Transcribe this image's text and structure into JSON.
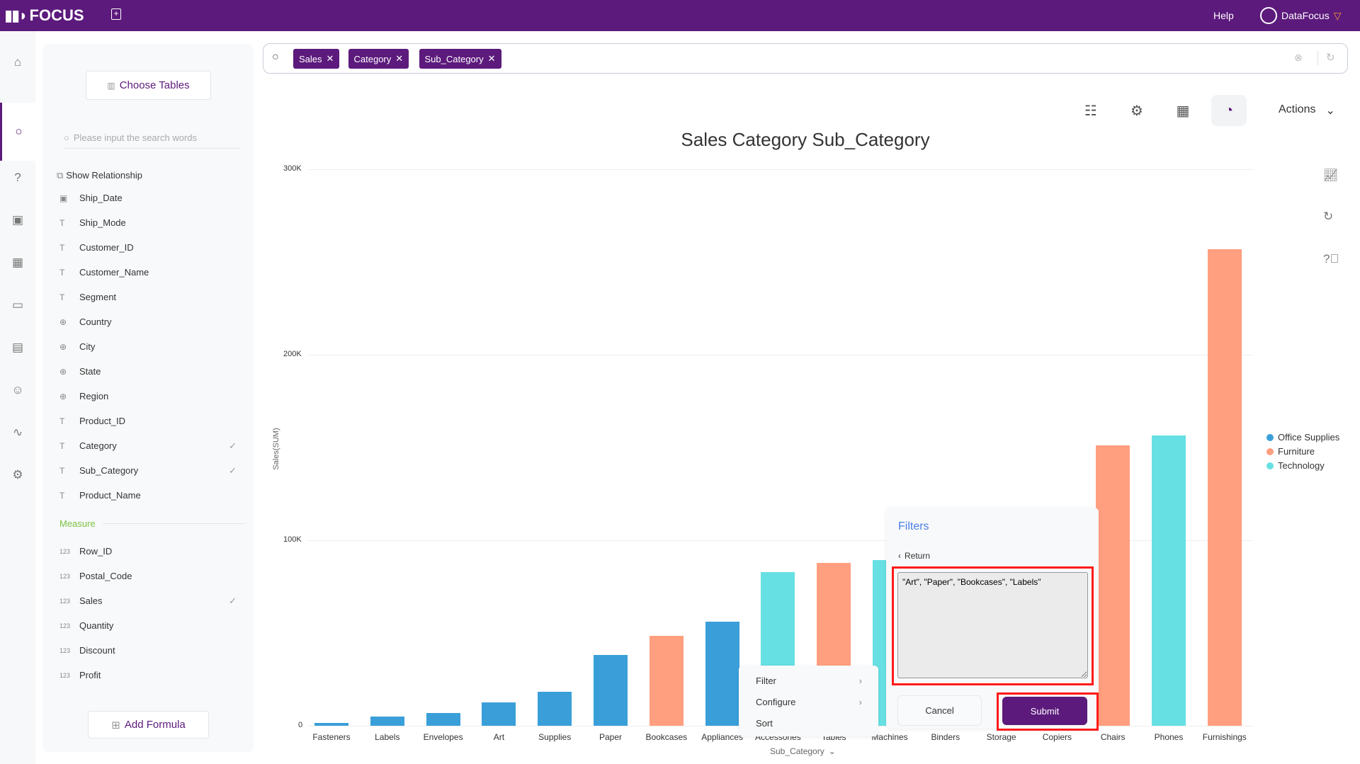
{
  "topbar": {
    "logo": "FOCUS",
    "help": "Help",
    "user": "DataFocus"
  },
  "rail": [
    "home-icon",
    "search-icon",
    "help-icon",
    "presentation-icon",
    "table-icon",
    "folder-icon",
    "clipboard-icon",
    "user-icon",
    "pulse-icon",
    "settings-icon"
  ],
  "panel": {
    "choose_tables": "Choose Tables",
    "search_placeholder": "Please input the search words",
    "show_relationship": "Show Relationship",
    "attributes": [
      {
        "name": "Ship_Date",
        "type": "date",
        "checked": false
      },
      {
        "name": "Ship_Mode",
        "type": "text",
        "checked": false
      },
      {
        "name": "Customer_ID",
        "type": "text",
        "checked": false
      },
      {
        "name": "Customer_Name",
        "type": "text",
        "checked": false
      },
      {
        "name": "Segment",
        "type": "text",
        "checked": false
      },
      {
        "name": "Country",
        "type": "geo",
        "checked": false
      },
      {
        "name": "City",
        "type": "geo",
        "checked": false
      },
      {
        "name": "State",
        "type": "geo",
        "checked": false
      },
      {
        "name": "Region",
        "type": "geo",
        "checked": false
      },
      {
        "name": "Product_ID",
        "type": "text",
        "checked": false
      },
      {
        "name": "Category",
        "type": "text",
        "checked": true
      },
      {
        "name": "Sub_Category",
        "type": "text",
        "checked": true
      },
      {
        "name": "Product_Name",
        "type": "text",
        "checked": false
      }
    ],
    "measure_label": "Measure",
    "measures": [
      {
        "name": "Row_ID",
        "checked": false
      },
      {
        "name": "Postal_Code",
        "checked": false
      },
      {
        "name": "Sales",
        "checked": true
      },
      {
        "name": "Quantity",
        "checked": false
      },
      {
        "name": "Discount",
        "checked": false
      },
      {
        "name": "Profit",
        "checked": false
      }
    ],
    "add_formula": "Add Formula"
  },
  "search": {
    "tags": [
      "Sales",
      "Category",
      "Sub_Category"
    ]
  },
  "toolbar": {
    "actions": "Actions"
  },
  "menu": {
    "filter": "Filter",
    "configure": "Configure",
    "sort": "Sort"
  },
  "filters": {
    "title": "Filters",
    "return": "Return",
    "value": "\"Art\", \"Paper\", \"Bookcases\", \"Labels\"",
    "cancel": "Cancel",
    "submit": "Submit"
  },
  "colors": {
    "brand": "#5c1a7c",
    "Office Supplies": "#3a9fd9",
    "Furniture": "#ff9f7f",
    "Technology": "#67e0e3",
    "highlight": "#ff1a1a"
  },
  "chart_data": {
    "type": "bar",
    "title": "Sales Category Sub_Category",
    "xlabel": "Sub_Category",
    "ylabel": "Sales(SUM)",
    "ylim": [
      0,
      300000
    ],
    "yticks": [
      "0",
      "100K",
      "200K",
      "300K"
    ],
    "grid": true,
    "legend_position": "right",
    "legend": [
      "Office Supplies",
      "Furniture",
      "Technology"
    ],
    "categories": [
      "Fasteners",
      "Labels",
      "Envelopes",
      "Art",
      "Supplies",
      "Paper",
      "Bookcases",
      "Appliances",
      "Accessories",
      "Tables",
      "Machines",
      "Binders",
      "Storage",
      "Copiers",
      "Chairs",
      "Phones",
      "Furnishings"
    ],
    "series_of": [
      "Office Supplies",
      "Office Supplies",
      "Office Supplies",
      "Office Supplies",
      "Office Supplies",
      "Office Supplies",
      "Furniture",
      "Office Supplies",
      "Technology",
      "Furniture",
      "Technology",
      "Office Supplies",
      "Office Supplies",
      "Technology",
      "Furniture",
      "Technology",
      "Furniture"
    ],
    "values": [
      1500,
      5100,
      7000,
      12600,
      18200,
      38000,
      48600,
      56000,
      82700,
      87900,
      89300,
      null,
      null,
      null,
      151000,
      156500,
      257000
    ]
  }
}
